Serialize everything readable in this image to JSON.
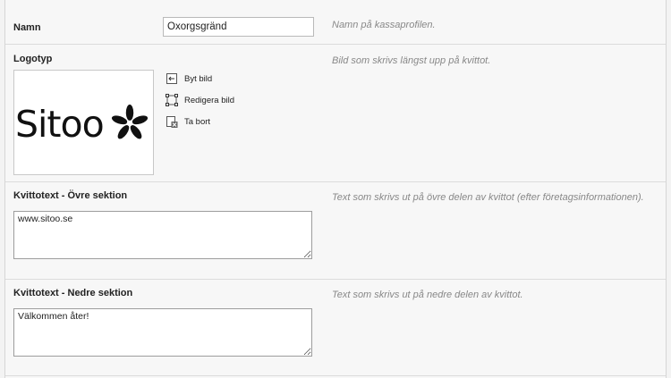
{
  "fields": {
    "name": {
      "label": "Namn",
      "value": "Oxorgsgränd",
      "help": "Namn på kassaprofilen."
    },
    "logo": {
      "label": "Logotyp",
      "help": "Bild som skrivs längst upp på kvittot.",
      "image_text": "Sitoo",
      "actions": [
        {
          "label": "Byt bild",
          "icon": "replace-image-icon"
        },
        {
          "label": "Redigera bild",
          "icon": "crop-icon"
        },
        {
          "label": "Ta bort",
          "icon": "delete-image-icon"
        }
      ]
    },
    "receipt_top": {
      "label": "Kvittotext - Övre sektion",
      "value": "www.sitoo.se",
      "help": "Text som skrivs ut på övre delen av kvittot (efter företagsinformationen)."
    },
    "receipt_bottom": {
      "label": "Kvittotext - Nedre sektion",
      "value": "Välkommen åter!",
      "help": "Text som skrivs ut på nedre delen av kvittot."
    }
  }
}
